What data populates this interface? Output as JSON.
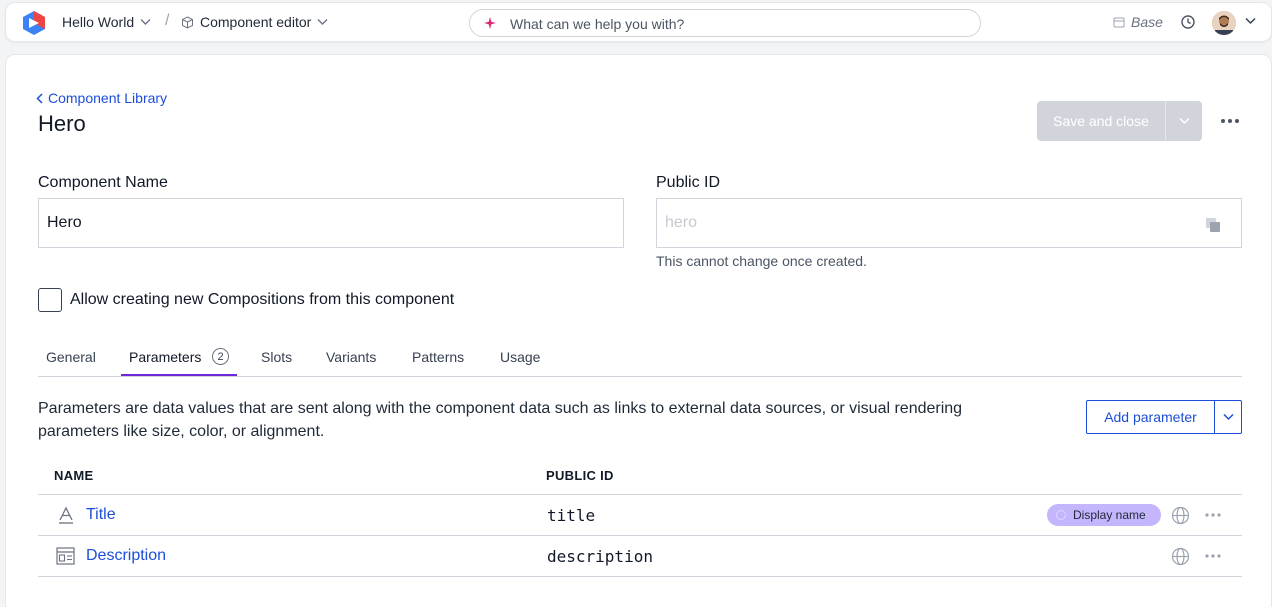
{
  "topbar": {
    "project": "Hello World",
    "separator": "/",
    "editor": "Component editor",
    "search_placeholder": "What can we help you with?",
    "environment": "Base"
  },
  "header": {
    "back_label": "Component Library",
    "title": "Hero",
    "save_label": "Save and close"
  },
  "form": {
    "name_label": "Component Name",
    "name_value": "Hero",
    "public_id_label": "Public ID",
    "public_id_placeholder": "hero",
    "public_id_hint": "This cannot change once created.",
    "checkbox_label": "Allow creating new Compositions from this component",
    "checkbox_checked": false
  },
  "tabs": [
    {
      "label": "General"
    },
    {
      "label": "Parameters",
      "count": "2",
      "active": true
    },
    {
      "label": "Slots"
    },
    {
      "label": "Variants"
    },
    {
      "label": "Patterns"
    },
    {
      "label": "Usage"
    }
  ],
  "parameters": {
    "description": "Parameters are data values that are sent along with the component data such as links to external data sources, or visual rendering parameters like size, color, or alignment.",
    "add_label": "Add parameter",
    "columns": [
      "NAME",
      "PUBLIC ID"
    ],
    "rows": [
      {
        "name": "Title",
        "public_id": "title",
        "icon": "text-icon",
        "badge": "Display name"
      },
      {
        "name": "Description",
        "public_id": "description",
        "icon": "rich-text-icon"
      }
    ]
  },
  "colors": {
    "accent": "#6d28d9",
    "link": "#1d4ed8",
    "badge": "#c4b5fd",
    "disabled_button": "#d1d5db"
  }
}
